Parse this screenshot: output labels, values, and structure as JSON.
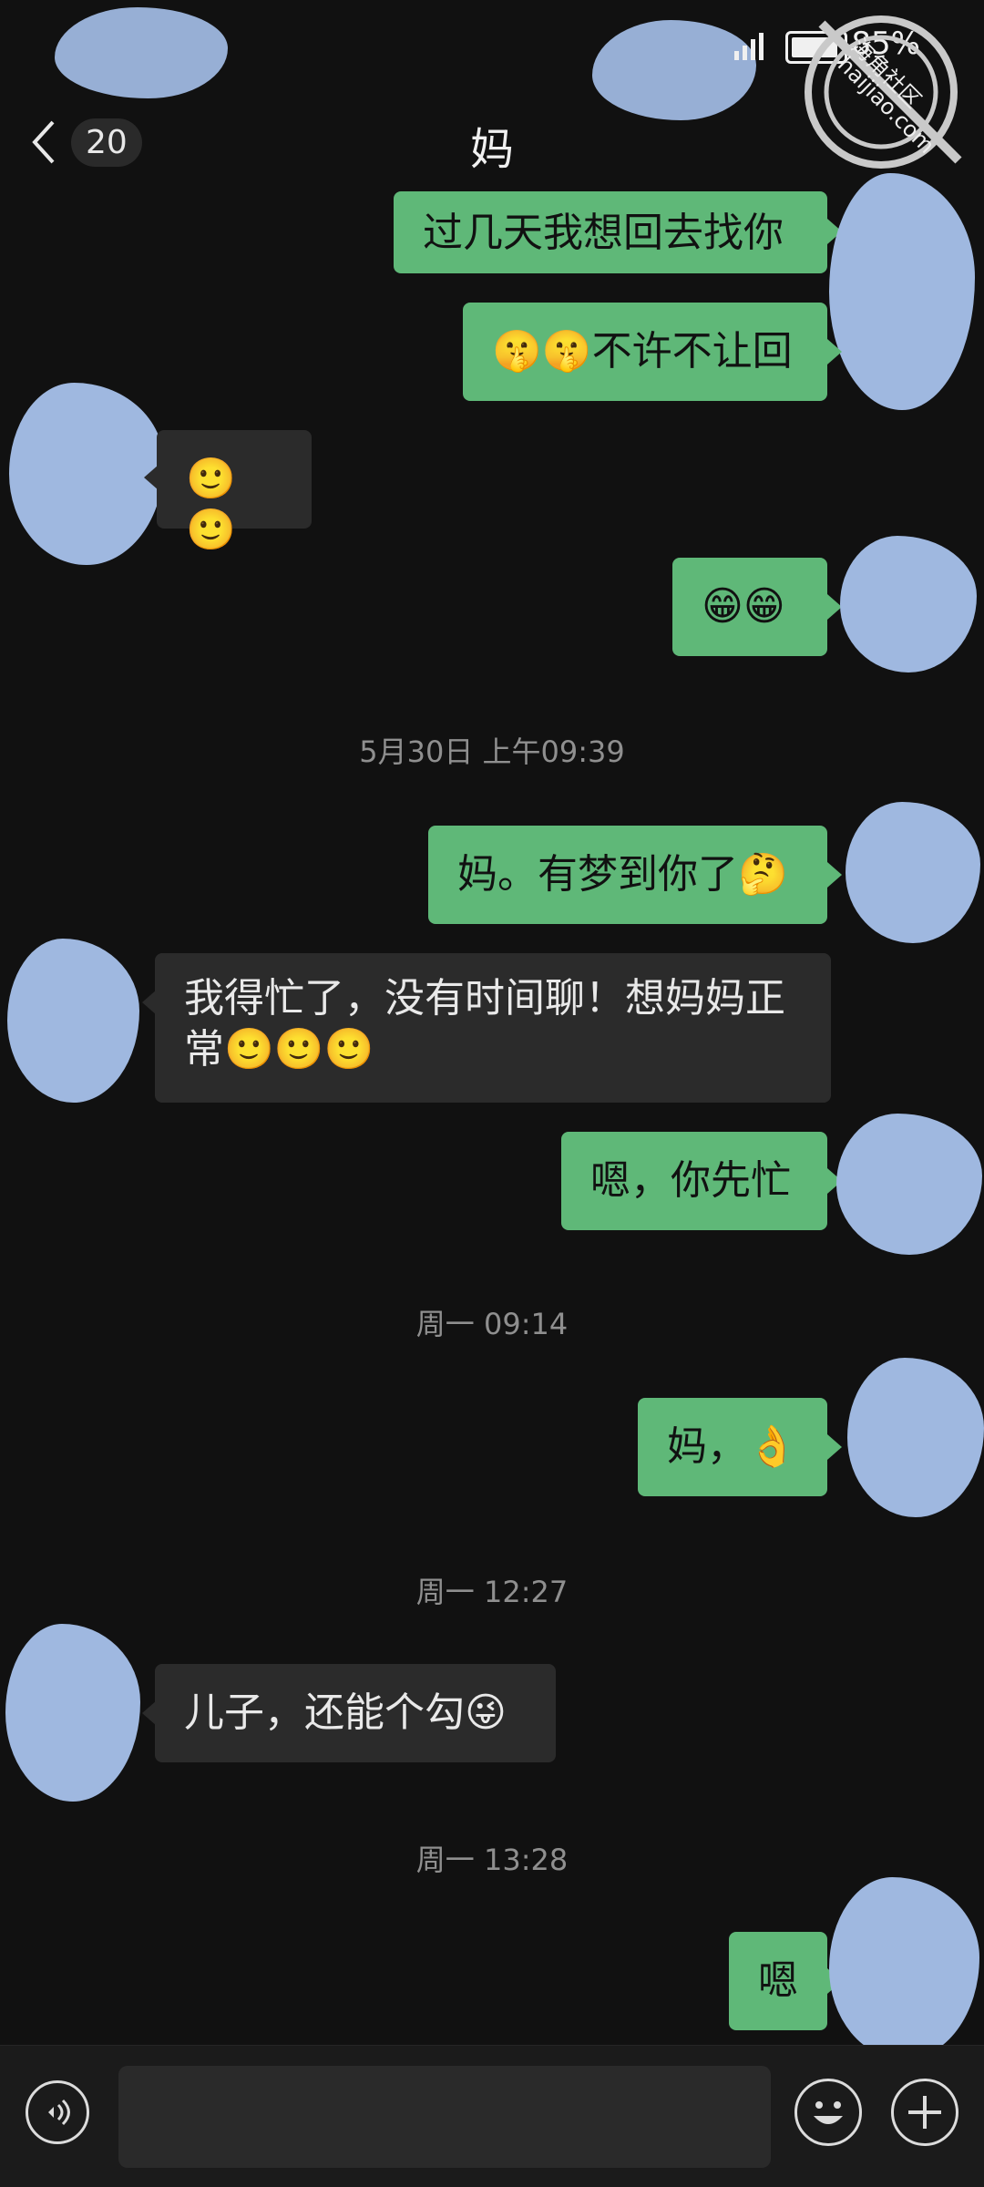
{
  "status": {
    "battery": "85%",
    "signal_icon": "signal-icon",
    "battery_icon": "battery-icon"
  },
  "watermark": {
    "lines": [
      "海角社区",
      "haijiao.com"
    ]
  },
  "header": {
    "back_icon": "chevron-left-icon",
    "unread_count": "20",
    "title": "妈"
  },
  "messages": [
    {
      "type": "out",
      "text": "过几天我想回去找你"
    },
    {
      "type": "out",
      "text": "🤫🤫不许不让回"
    },
    {
      "type": "in",
      "text": "🙂🙂"
    },
    {
      "type": "out",
      "text": "😁😁"
    },
    {
      "type": "time",
      "text": "5月30日 上午09:39"
    },
    {
      "type": "out",
      "text": "妈。有梦到你了🤔"
    },
    {
      "type": "in",
      "text": "我得忙了，没有时间聊！想妈妈正常🙂🙂🙂"
    },
    {
      "type": "out",
      "text": "嗯，你先忙"
    },
    {
      "type": "time",
      "text": "周一 09:14"
    },
    {
      "type": "out",
      "text": "妈，👌"
    },
    {
      "type": "time",
      "text": "周一 12:27"
    },
    {
      "type": "in",
      "text": "儿子，还能个勾😜"
    },
    {
      "type": "time",
      "text": "周一 13:28"
    },
    {
      "type": "out",
      "text": "嗯"
    }
  ],
  "input_bar": {
    "voice_icon": "voice-icon",
    "emoji_icon": "emoji-icon",
    "plus_icon": "plus-icon",
    "placeholder": ""
  }
}
